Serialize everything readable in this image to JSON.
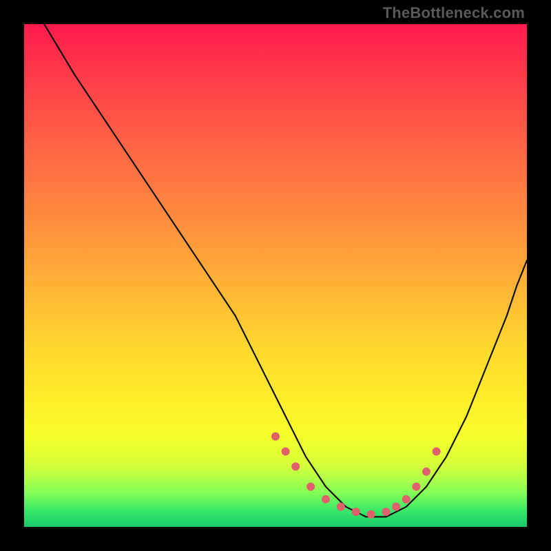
{
  "watermark": "TheBottleneck.com",
  "chart_data": {
    "type": "line",
    "title": "",
    "xlabel": "",
    "ylabel": "",
    "xlim": [
      0,
      100
    ],
    "ylim": [
      0,
      100
    ],
    "grid": false,
    "series": [
      {
        "name": "bottleneck-curve",
        "x": [
          4,
          10,
          18,
          26,
          34,
          42,
          48,
          52,
          56,
          60,
          64,
          68,
          72,
          76,
          80,
          84,
          88,
          92,
          96,
          98,
          100
        ],
        "y": [
          100,
          90,
          78,
          66,
          54,
          42,
          30,
          22,
          14,
          8,
          4,
          2,
          2,
          4,
          8,
          14,
          22,
          32,
          42,
          48,
          53
        ]
      }
    ],
    "markers": {
      "name": "highlighted-points",
      "x": [
        50,
        52,
        54,
        57,
        60,
        63,
        66,
        69,
        72,
        74,
        76,
        78,
        80,
        82
      ],
      "y": [
        18,
        15,
        12,
        8,
        5.5,
        4,
        3,
        2.5,
        3,
        4,
        5.5,
        8,
        11,
        15
      ]
    },
    "background_gradient": {
      "direction": "vertical",
      "stops": [
        {
          "pos": 0,
          "color": "#ff1a4d"
        },
        {
          "pos": 0.5,
          "color": "#ffc733"
        },
        {
          "pos": 0.82,
          "color": "#f6ff2a"
        },
        {
          "pos": 1.0,
          "color": "#19c96a"
        }
      ]
    }
  }
}
